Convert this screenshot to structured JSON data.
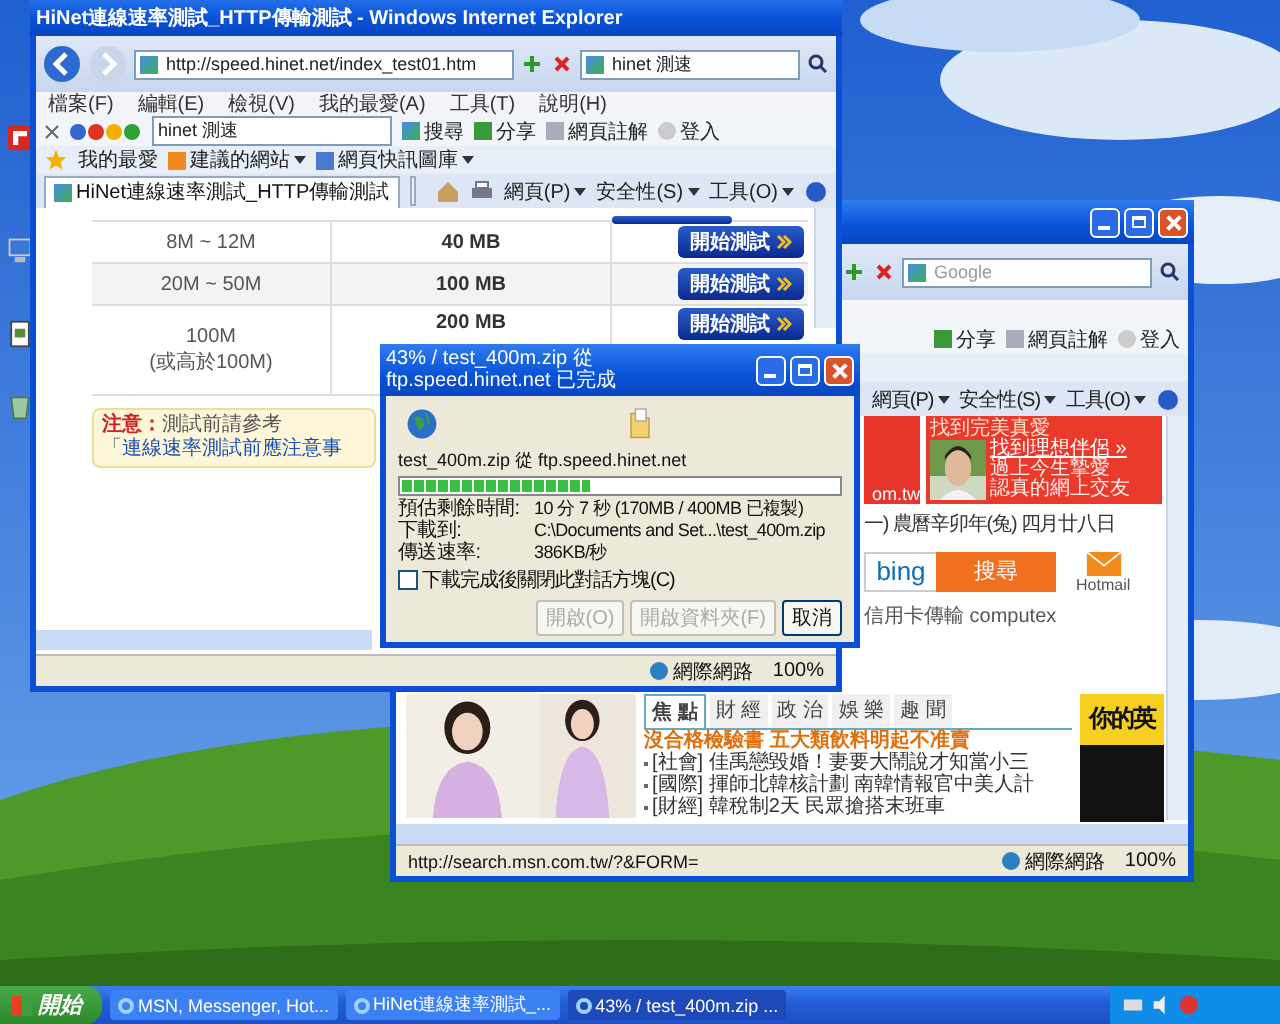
{
  "front_window": {
    "title": "HiNet連線速率測試_HTTP傳輸測試 - Windows Internet Explorer",
    "address": "http://speed.hinet.net/index_test01.htm",
    "search_value": "hinet 測速",
    "menu": [
      "檔案(F)",
      "編輯(E)",
      "檢視(V)",
      "我的最愛(A)",
      "工具(T)",
      "說明(H)"
    ],
    "google_toolbar": {
      "query": "hinet 測速",
      "items": [
        "搜尋",
        "分享",
        "網頁註解",
        "登入"
      ]
    },
    "favorites_bar": [
      "我的最愛",
      "建議的網站",
      "網頁快訊圖庫"
    ],
    "tabs": [
      {
        "label": "HiNet連線速率測試_HTTP傳輸測試",
        "selected": true
      }
    ],
    "command_bar": [
      "網頁(P)",
      "安全性(S)",
      "工具(O)"
    ],
    "speed_rows": [
      {
        "speed": "8M ~ 12M",
        "size": "40 MB",
        "action": "開始測試"
      },
      {
        "speed": "20M ~ 50M",
        "size": "100 MB",
        "action": "開始測試"
      },
      {
        "speed": "100M",
        "speed_note": "(或高於100M)",
        "size": "200 MB",
        "action": "開始測試"
      }
    ],
    "notice": {
      "label": "注意：",
      "text": "測試前請參考「",
      "link": "連線速率測試前應注意事"
    },
    "status_bar": {
      "zone": "網際網路",
      "zoom": "100%"
    }
  },
  "download_dialog": {
    "title": "43% / test_400m.zip 從 ftp.speed.hinet.net 已完成",
    "source": "test_400m.zip 從 ftp.speed.hinet.net",
    "level": 0.43,
    "fields": [
      {
        "label": "預估剩餘時間:",
        "value": "10 分 7 秒 (170MB / 400MB 已複製)"
      },
      {
        "label": "下載到:",
        "value": "C:\\Documents and Set...\\test_400m.zip"
      },
      {
        "label": "傳送速率:",
        "value": "386KB/秒"
      }
    ],
    "close_when_done": {
      "label": "下載完成後關閉此對話方塊(C)",
      "checked": false
    },
    "buttons": [
      {
        "label": "開啟(O)",
        "disabled": true
      },
      {
        "label": "開啟資料夾(F)",
        "disabled": true
      },
      {
        "label": "取消",
        "disabled": false
      }
    ]
  },
  "back_window": {
    "search_placeholder": "Google",
    "google_toolbar": [
      "分享",
      "網頁註解",
      "登入"
    ],
    "command_bar": [
      "網頁(P)",
      "安全性(S)",
      "工具(O)"
    ],
    "ad_left": "om.tw",
    "ad_right": {
      "heading": "找到完美真愛",
      "link": "找到理想伴侶 »",
      "lines": [
        "過上今生摯愛",
        "認真的網上交友"
      ]
    },
    "date": "一) 農曆辛卯年(兔) 四月廿八日",
    "bing": "bing",
    "search_button": "搜尋",
    "hot_searches": "信用卡傳輸 computex",
    "hotmail": "Hotmail",
    "news_tabs": [
      {
        "label": "焦 點",
        "selected": true
      },
      {
        "label": "財 經",
        "selected": false
      },
      {
        "label": "政 治",
        "selected": false
      },
      {
        "label": "娛 樂",
        "selected": false
      },
      {
        "label": "趣 聞",
        "selected": false
      }
    ],
    "headlines": [
      {
        "kind": "top",
        "text": "沒合格檢驗書 五大類飲料明起不准賣"
      },
      {
        "kind": "item",
        "tag": "[社會]",
        "text": "佳禹戀毀婚！妻要大鬧說才知當小三"
      },
      {
        "kind": "item",
        "tag": "[國際]",
        "text": "揮師北韓核計劃 南韓情報官中美人計"
      },
      {
        "kind": "item",
        "tag": "[財經]",
        "text": "韓稅制2天 民眾搶搭末班車"
      }
    ],
    "ad_banner": "你的英",
    "status_bar": {
      "url": "http://search.msn.com.tw/?&FORM=",
      "zone": "網際網路",
      "zoom": "100%"
    }
  },
  "taskbar": {
    "start": "開始",
    "items": [
      {
        "label": "MSN, Messenger, Hot...",
        "selected": false
      },
      {
        "label": "HiNet連線速率測試_...",
        "selected": false
      },
      {
        "label": "43% / test_400m.zip ...",
        "selected": true
      }
    ]
  }
}
